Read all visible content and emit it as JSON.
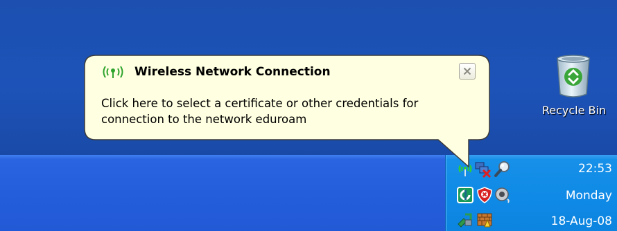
{
  "desktop": {
    "recycle_bin": {
      "label": "Recycle Bin",
      "icon": "recycle-bin-icon"
    }
  },
  "balloon": {
    "title": "Wireless Network Connection",
    "message": "Click here to select a certificate or other credentials for connection to the network eduroam",
    "title_icon": "wireless-signal-icon",
    "close_icon": "close-icon"
  },
  "tray": {
    "icons": [
      "wireless-network-icon",
      "network-disconnected-icon",
      "search-icon",
      "sync-icon",
      "security-shield-icon",
      "speaker-icon",
      "safely-remove-hardware-icon",
      "firewall-icon"
    ],
    "clock": {
      "time": "22:53",
      "day": "Monday",
      "date": "18-Aug-08"
    }
  },
  "colors": {
    "desktop_blue": "#1c4fb0",
    "taskbar_blue": "#245edb",
    "tray_blue": "#0f8ae6",
    "balloon_bg": "#ffffe1",
    "balloon_border": "#3a3a3a"
  }
}
